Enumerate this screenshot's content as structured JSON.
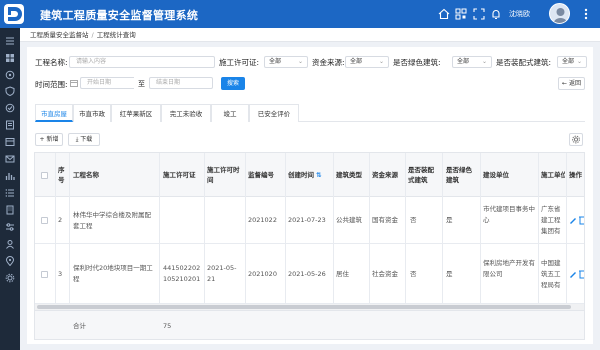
{
  "app": {
    "title": "建筑工程质量安全监督管理系统",
    "username": "沈晓欧"
  },
  "colors": {
    "header": "#1c67c4",
    "sidebar": "#1e2a3a",
    "accent": "#1a84e8"
  },
  "breadcrumb": [
    "工程质量安全监督站",
    "工程统计查询"
  ],
  "filters": {
    "name_label": "工程名称:",
    "name_placeholder": "请输入内容",
    "permit_label": "施工许可证:",
    "permit_value": "全部",
    "funding_label": "资金来源:",
    "funding_value": "全部",
    "green_label": "是否绿色建筑:",
    "green_value": "全部",
    "prefab_label": "是否装配式建筑:",
    "prefab_value": "全部",
    "time_label": "时间范围:",
    "start_placeholder": "开始日期",
    "to_label": "至",
    "end_placeholder": "结束日期",
    "search_label": "搜索",
    "back_label": "← 返回"
  },
  "tabs": [
    "市直房屋",
    "市直市政",
    "红苹果新区",
    "完工未验收",
    "竣工",
    "已安全评价"
  ],
  "toolbar": {
    "add_label": "+ 新增",
    "download_label": "下载"
  },
  "table": {
    "headers": {
      "seq": "序号",
      "name": "工程名称",
      "permit": "施工许可证",
      "permit_time": "施工许可时间",
      "supervision_no": "监督编号",
      "created": "创建时间",
      "building_type": "建筑类型",
      "funding": "资金来源",
      "prefab": "是否装配式建筑",
      "green": "是否绿色建筑",
      "builder": "建设单位",
      "constructor": "施工单位",
      "ops": "操作"
    },
    "rows": [
      {
        "seq": "2",
        "name": "林伟华中学综合楼及附属配套工程",
        "permit": "",
        "permit_time": "",
        "supervision_no": "2021022",
        "created": "2021-07-23",
        "building_type": "公共建筑",
        "funding": "国有资金",
        "prefab": "否",
        "green": "是",
        "builder": "市代建项目事务中心",
        "constructor": "广东省建工程集团有限"
      },
      {
        "seq": "3",
        "name": "保利时代20地块项目一期工程",
        "permit": "441502202105210201",
        "permit_time": "2021-05-21",
        "supervision_no": "2021020",
        "created": "2021-05-26",
        "building_type": "居住",
        "funding": "社会资金",
        "prefab": "否",
        "green": "是",
        "builder": "保利房地产开发有限公司",
        "constructor": "中国建筑五工程局有"
      }
    ],
    "footer": {
      "label": "合计",
      "permit_total": "75"
    }
  }
}
